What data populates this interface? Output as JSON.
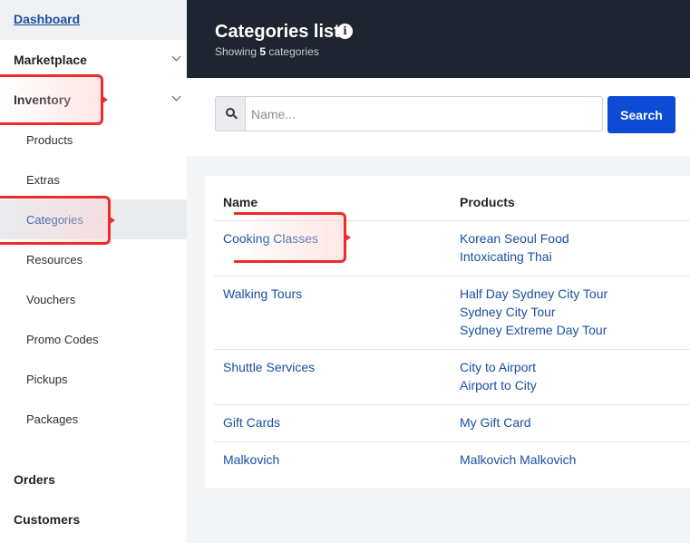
{
  "sidebar": {
    "dashboard": "Dashboard",
    "marketplace": "Marketplace",
    "inventory": "Inventory",
    "inventory_items": [
      "Products",
      "Extras",
      "Categories",
      "Resources",
      "Vouchers",
      "Promo Codes",
      "Pickups",
      "Packages"
    ],
    "active_item": "Categories",
    "orders": "Orders",
    "customers": "Customers"
  },
  "header": {
    "title": "Categories list",
    "info_icon": "i",
    "showing_prefix": "Showing",
    "showing_count": "5",
    "showing_suffix": "categories"
  },
  "search": {
    "placeholder": "Name...",
    "value": "",
    "button_label": "Search",
    "icon": "search-icon"
  },
  "table": {
    "columns": [
      "Name",
      "Products"
    ],
    "rows": [
      {
        "name": "Cooking Classes",
        "products": [
          "Korean Seoul Food",
          "Intoxicating Thai"
        ]
      },
      {
        "name": "Walking Tours",
        "products": [
          "Half Day Sydney City Tour",
          "Sydney City Tour",
          "Sydney Extreme Day Tour"
        ]
      },
      {
        "name": "Shuttle Services",
        "products": [
          "City to Airport",
          "Airport to City"
        ]
      },
      {
        "name": "Gift Cards",
        "products": [
          "My Gift Card"
        ]
      },
      {
        "name": "Malkovich",
        "products": [
          "Malkovich Malkovich"
        ]
      }
    ]
  },
  "colors": {
    "header_bg": "#1e2530",
    "link": "#1a4fa3",
    "primary_button": "#0d4bd6",
    "highlight": "#ee2a2a"
  }
}
